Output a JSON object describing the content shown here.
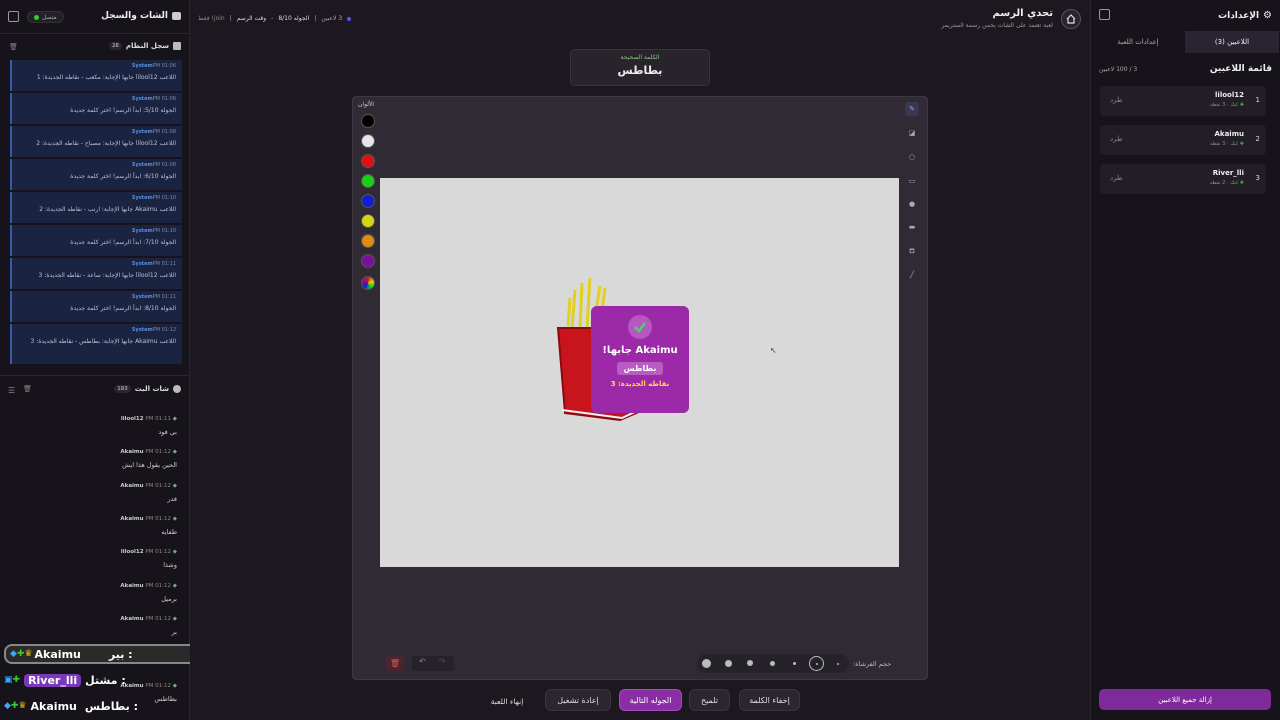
{
  "left": {
    "title": "الشات والسجل",
    "status": "متصل",
    "system_log": {
      "title": "سجل النظام",
      "count": "28",
      "messages": [
        {
          "sender": "System",
          "time": "PM 01:06",
          "text": "اللاعب lilool12 جابها الإجابة: مكعب - نقاطه الجديدة: 1"
        },
        {
          "sender": "System",
          "time": "PM 01:06",
          "text": "الجولة 5/10: ابدأ الرسم! اختر كلمة جديدة"
        },
        {
          "sender": "System",
          "time": "PM 01:08",
          "text": "اللاعب lilool12 جابها الإجابة: مصباح - نقاطه الجديدة: 2"
        },
        {
          "sender": "System",
          "time": "PM 01:08",
          "text": "الجولة 6/10: ابدأ الرسم! اختر كلمة جديدة"
        },
        {
          "sender": "System",
          "time": "PM 01:10",
          "text": "اللاعب Akaimu جابها الإجابة: ارنب - نقاطه الجديدة: 2"
        },
        {
          "sender": "System",
          "time": "PM 01:10",
          "text": "الجولة 7/10: ابدأ الرسم! اختر كلمة جديدة"
        },
        {
          "sender": "System",
          "time": "PM 01:11",
          "text": "اللاعب lilool12 جابها الإجابة: ساعة - نقاطه الجديدة: 3"
        },
        {
          "sender": "System",
          "time": "PM 01:11",
          "text": "الجولة 8/10: ابدأ الرسم! اختر كلمة جديدة"
        },
        {
          "sender": "System",
          "time": "PM 01:12",
          "text": "اللاعب Akaimu جابها الإجابة: بطاطس - نقاطه الجديدة: 3"
        }
      ]
    },
    "live_chat": {
      "title": "شات البث",
      "count": "183",
      "messages": [
        {
          "user": "lilool12",
          "time": "PM 01:11",
          "text": "بي فود"
        },
        {
          "user": "Akaimu",
          "time": "PM 01:12",
          "text": "الحين يقول هذا ايش"
        },
        {
          "user": "Akaimu",
          "time": "PM 01:12",
          "text": "قدر"
        },
        {
          "user": "Akaimu",
          "time": "PM 01:12",
          "text": "طفايه"
        },
        {
          "user": "lilool12",
          "time": "PM 01:12",
          "text": "وشذا"
        },
        {
          "user": "Akaimu",
          "time": "PM 01:12",
          "text": "برميل"
        },
        {
          "user": "Akaimu",
          "time": "PM 01:12",
          "text": "بر"
        },
        {
          "user": "Akaimu",
          "time": "PM 01:12",
          "text": "بطاطس"
        }
      ]
    }
  },
  "overlay_chat": [
    {
      "user": "Akaimu",
      "text": "بير :"
    },
    {
      "user": "River_lli",
      "text": "مشتل :"
    },
    {
      "user": "Akaimu",
      "text": "بطاطس :"
    }
  ],
  "header": {
    "title": "تحدي الرسم",
    "subtitle": "لعبة تعتمد على الشات يخمن رسمة الستريمر",
    "round": "الجوله 8/10",
    "time_label": "وقت الرسم",
    "join_label": "join! فقط",
    "players_count": "3 لاعبين"
  },
  "word_box": {
    "label": "الكلمة الصحيحة",
    "word": "بطاطس"
  },
  "palette": {
    "title": "الألوان",
    "colors": [
      "#000000",
      "#e6e6e6",
      "#e01010",
      "#18d018",
      "#1020d0",
      "#d6d610",
      "#e08a10",
      "#7a109a"
    ]
  },
  "popup": {
    "title": "Akaimu جابها!",
    "word": "بطاطس",
    "points": "نقاطه الجديدة: 3"
  },
  "brush": {
    "label": "حجم الفرشاة:"
  },
  "actions": {
    "end_game": "إنهاء اللعبة",
    "restart": "إعادة تشغيل",
    "next_round": "الجوله التالية",
    "hint": "تلميح",
    "hide_word": "إخفاء الكلمة"
  },
  "right": {
    "title": "الإعدادات",
    "tab_players": "اللاعبين (3)",
    "tab_settings": "إعدادات اللعبة",
    "list_title": "قائمة اللاعبين",
    "capacity": "3 / 100 لاعبين",
    "kick_label": "طرد",
    "players": [
      {
        "rank": "1",
        "name": "lilool12",
        "points": "3 نقطة",
        "badge": "كيك"
      },
      {
        "rank": "2",
        "name": "Akaimu",
        "points": "3 نقطة",
        "badge": "كيك"
      },
      {
        "rank": "3",
        "name": "River_lli",
        "points": "2 نقطة",
        "badge": "كيك"
      }
    ],
    "remove_all": "إزالة جميع اللاعبين"
  }
}
